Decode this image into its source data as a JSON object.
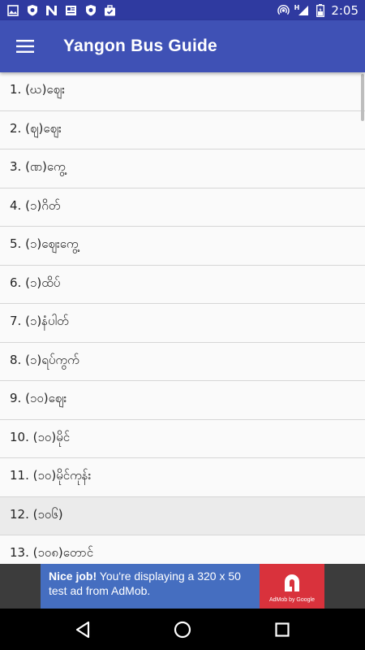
{
  "status_bar": {
    "time": "2:05",
    "left_icons": [
      "image-icon",
      "shield-icon",
      "n-icon",
      "newspaper-icon",
      "shield-icon",
      "briefcase-check-icon"
    ],
    "right_icons": [
      "hotspot-icon",
      "cell-signal-icon",
      "battery-icon"
    ],
    "signal_label": "H"
  },
  "app_bar": {
    "title": "Yangon Bus Guide",
    "background": "#3f51b5",
    "status_background": "#2f3aa0"
  },
  "list": {
    "items": [
      {
        "label": "1. (ဃ)ဈေး"
      },
      {
        "label": "2. (ဈ)ဈေး"
      },
      {
        "label": "3. (ဏ)ကွေ့"
      },
      {
        "label": "4. (၁)ဂိတ်"
      },
      {
        "label": "5. (၁)ဈေးကွေ့"
      },
      {
        "label": "6. (၁)ထိပ်"
      },
      {
        "label": "7. (၁)နံပါတ်"
      },
      {
        "label": "8. (၁)ရပ်ကွက်"
      },
      {
        "label": "9. (၁၀)ဈေး"
      },
      {
        "label": "10. (၁၀)မိုင်"
      },
      {
        "label": "11. (၁၀)မိုင်ကုန်း"
      },
      {
        "label": "12. (၁၀၆)",
        "selected": true
      },
      {
        "label": "13. (၁၀၈)တောင်"
      }
    ]
  },
  "ad": {
    "bold_text": "Nice job!",
    "text": " You're displaying a 320 x 50 test ad from AdMob.",
    "logo_caption": "AdMob by Google"
  },
  "nav_bar": {
    "icons": [
      "back-icon",
      "home-icon",
      "recents-icon"
    ]
  }
}
